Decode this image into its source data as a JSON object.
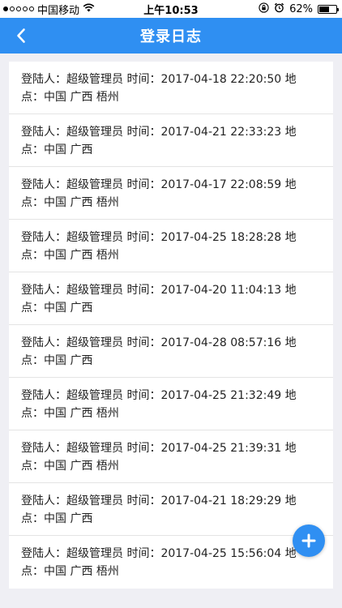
{
  "status_bar": {
    "carrier": "中国移动",
    "time": "上午10:53",
    "battery": "62%",
    "battery_level": 0.62
  },
  "nav": {
    "title": "登录日志"
  },
  "logs": [
    {
      "text": "登陆人：超级管理员 时间：2017-04-18 22:20:50 地点：中国 广西 梧州"
    },
    {
      "text": "登陆人：超级管理员 时间：2017-04-21 22:33:23 地点：中国 广西"
    },
    {
      "text": "登陆人：超级管理员 时间：2017-04-17 22:08:59 地点：中国 广西 梧州"
    },
    {
      "text": "登陆人：超级管理员 时间：2017-04-25 18:28:28 地点：中国 广西 梧州"
    },
    {
      "text": "登陆人：超级管理员 时间：2017-04-20 11:04:13 地点：中国 广西"
    },
    {
      "text": "登陆人：超级管理员 时间：2017-04-28 08:57:16 地点：中国 广西"
    },
    {
      "text": "登陆人：超级管理员 时间：2017-04-25 21:32:49 地点：中国 广西 梧州"
    },
    {
      "text": "登陆人：超级管理员 时间：2017-04-25 21:39:31 地点：中国 广西 梧州"
    },
    {
      "text": "登陆人：超级管理员 时间：2017-04-21 18:29:29 地点：中国 广西"
    },
    {
      "text": "登陆人：超级管理员 时间：2017-04-25 15:56:04 地点：中国 广西 梧州"
    }
  ],
  "icons": {
    "back": "chevron-left-icon",
    "fab": "plus-icon",
    "wifi": "wifi-icon",
    "lock": "orientation-lock-icon",
    "alarm": "alarm-icon",
    "battery": "battery-icon"
  },
  "colors": {
    "accent": "#2f8ff2",
    "background": "#efeff4"
  }
}
